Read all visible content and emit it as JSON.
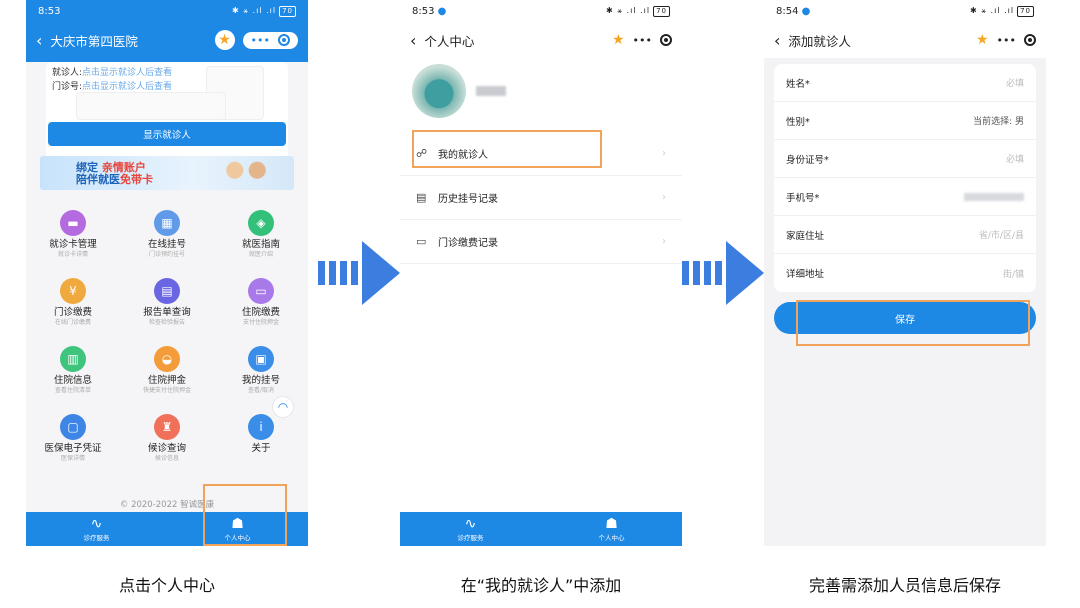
{
  "colors": {
    "primary": "#1e88e5",
    "highlight_box": "#f0a35a",
    "arrow": "#3b7ee0"
  },
  "screen1": {
    "time": "8:53",
    "battery": "70",
    "title": "大庆市第四医院",
    "patient_label": "就诊人:",
    "patient_value": "点击显示就诊人后查看",
    "clinic_label": "门诊号:",
    "clinic_value": "点击显示就诊人后查看",
    "show_button": "显示就诊人",
    "banner_line1": "绑定",
    "banner_line1_hl": "亲情账户",
    "banner_line2": "陪伴就医",
    "banner_line2_hl": "免带卡",
    "grid": [
      {
        "label": "就诊卡管理",
        "sub": "就诊卡详情",
        "icon": "card-icon",
        "color": "#b56be0",
        "glyph": "▬"
      },
      {
        "label": "在线挂号",
        "sub": "门诊预约挂号",
        "icon": "calendar-icon",
        "color": "#5f9be8",
        "glyph": "▦"
      },
      {
        "label": "就医指南",
        "sub": "就医介绍",
        "icon": "compass-icon",
        "color": "#33c07a",
        "glyph": "◈"
      },
      {
        "label": "门诊缴费",
        "sub": "在线门诊缴费",
        "icon": "payment-icon",
        "color": "#f0a93c",
        "glyph": "¥"
      },
      {
        "label": "报告单查询",
        "sub": "检查检验报告",
        "icon": "report-icon",
        "color": "#6a66e3",
        "glyph": "▤"
      },
      {
        "label": "住院缴费",
        "sub": "支付住院押金",
        "icon": "bed-icon",
        "color": "#a879e8",
        "glyph": "▭"
      },
      {
        "label": "住院信息",
        "sub": "查看住院清单",
        "icon": "document-icon",
        "color": "#3ec47d",
        "glyph": "▥"
      },
      {
        "label": "住院押金",
        "sub": "快捷支付住院押金",
        "icon": "deposit-icon",
        "color": "#f39c3a",
        "glyph": "◒"
      },
      {
        "label": "我的挂号",
        "sub": "查看/取消",
        "icon": "ticket-icon",
        "color": "#3b8ee8",
        "glyph": "▣"
      },
      {
        "label": "医保电子凭证",
        "sub": "医保详情",
        "icon": "insurance-icon",
        "color": "#3d86e6",
        "glyph": "▢"
      },
      {
        "label": "候诊查询",
        "sub": "候诊信息",
        "icon": "queue-icon",
        "color": "#f0705a",
        "glyph": "♜"
      },
      {
        "label": "关于",
        "sub": "",
        "icon": "info-icon",
        "color": "#3b8ee8",
        "glyph": "i"
      }
    ],
    "copyright": "© 2020-2022 智诚医康",
    "tab_service": "诊疗服务",
    "tab_personal": "个人中心"
  },
  "screen2": {
    "time": "8:53",
    "battery": "70",
    "title": "个人中心",
    "menu": [
      {
        "label": "我的就诊人",
        "icon": "people-icon",
        "glyph": "☍"
      },
      {
        "label": "历史挂号记录",
        "icon": "record-icon",
        "glyph": "▤"
      },
      {
        "label": "门诊缴费记录",
        "icon": "wallet-icon",
        "glyph": "▭"
      }
    ],
    "tab_service": "诊疗服务",
    "tab_personal": "个人中心"
  },
  "screen3": {
    "time": "8:54",
    "battery": "70",
    "title": "添加就诊人",
    "fields": [
      {
        "label": "姓名*",
        "value": "必填",
        "dark": false
      },
      {
        "label": "性别*",
        "value": "当前选择: 男",
        "dark": true
      },
      {
        "label": "身份证号*",
        "value": "必填",
        "dark": false
      },
      {
        "label": "手机号*",
        "value": "",
        "dark": false
      },
      {
        "label": "家庭住址",
        "value": "省/市/区/县",
        "dark": false
      },
      {
        "label": "详细地址",
        "value": "街/镇",
        "dark": false
      }
    ],
    "save_button": "保存"
  },
  "captions": [
    "点击个人中心",
    "在“我的就诊人”中添加",
    "完善需添加人员信息后保存"
  ]
}
